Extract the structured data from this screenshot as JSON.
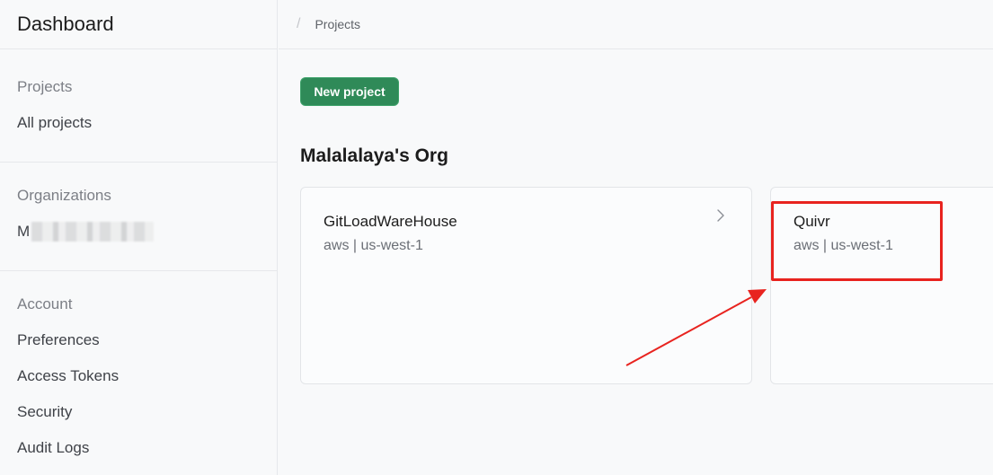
{
  "sidebar": {
    "title": "Dashboard",
    "sections": [
      {
        "heading": "Projects",
        "items": [
          "All projects"
        ]
      },
      {
        "heading": "Organizations",
        "redacted_item_initial": "M"
      },
      {
        "heading": "Account",
        "items": [
          "Preferences",
          "Access Tokens",
          "Security",
          "Audit Logs"
        ]
      }
    ]
  },
  "breadcrumb": {
    "separator": "/",
    "current": "Projects"
  },
  "main": {
    "new_project_label": "New project",
    "org_name": "Malalalaya's Org",
    "projects": [
      {
        "name": "GitLoadWareHouse",
        "meta": "aws | us-west-1"
      },
      {
        "name": "Quivr",
        "meta": "aws | us-west-1"
      }
    ]
  },
  "colors": {
    "accent_green": "#2f8a58",
    "annotation_red": "#e8231f"
  },
  "icons": {
    "card_chevron": "chevron-right-icon"
  }
}
